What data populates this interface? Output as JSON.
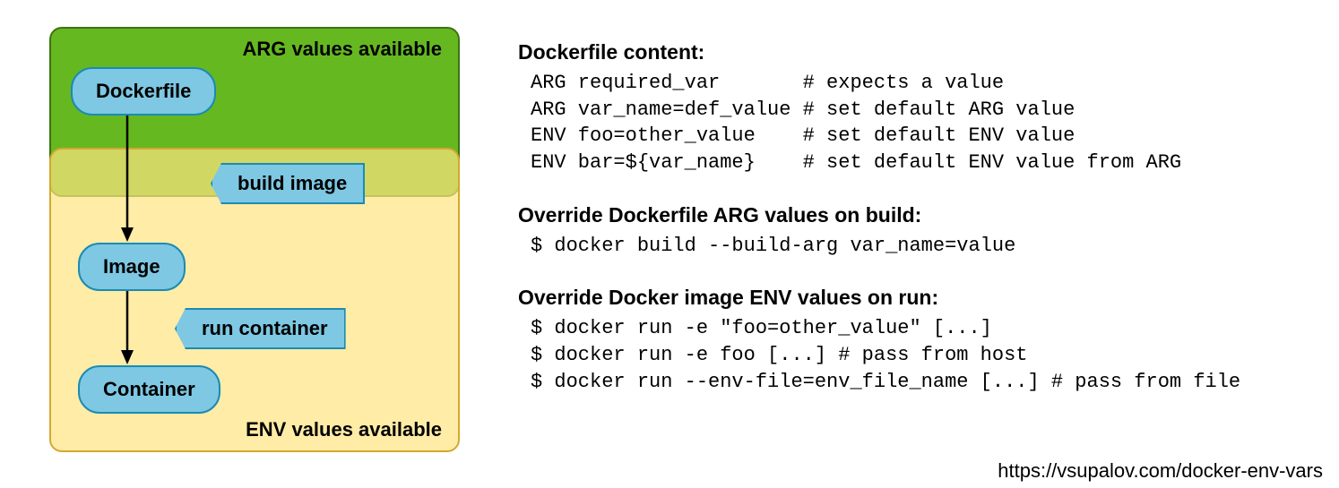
{
  "diagram": {
    "arg_region_label": "ARG values available",
    "env_region_label": "ENV values available",
    "nodes": {
      "dockerfile": "Dockerfile",
      "image": "Image",
      "container": "Container"
    },
    "actions": {
      "build": "build image",
      "run": "run container"
    }
  },
  "sections": {
    "dockerfile_content": {
      "heading": "Dockerfile content:",
      "lines": [
        "ARG required_var       # expects a value",
        "ARG var_name=def_value # set default ARG value",
        "ENV foo=other_value    # set default ENV value",
        "ENV bar=${var_name}    # set default ENV value from ARG"
      ]
    },
    "override_arg": {
      "heading": "Override Dockerfile ARG values on build:",
      "lines": [
        "$ docker build --build-arg var_name=value"
      ]
    },
    "override_env": {
      "heading": "Override Docker image ENV values on run:",
      "lines": [
        "$ docker run -e \"foo=other_value\" [...]",
        "$ docker run -e foo [...] # pass from host",
        "$ docker run --env-file=env_file_name [...] # pass from file"
      ]
    }
  },
  "attribution": "https://vsupalov.com/docker-env-vars"
}
